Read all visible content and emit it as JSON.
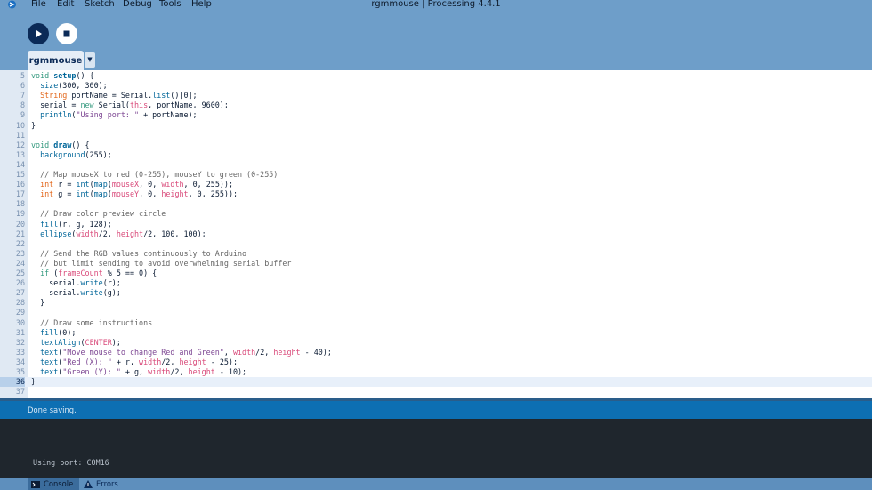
{
  "window": {
    "title": "rgmmouse | Processing 4.4.1"
  },
  "menu": {
    "items": [
      "File",
      "Edit",
      "Sketch",
      "Debug",
      "Tools",
      "Help"
    ]
  },
  "toolbar": {
    "run_icon": "play-icon",
    "stop_icon": "stop-icon"
  },
  "tabs": {
    "active_label": "rgmmouse",
    "menu_icon": "chevron-down-icon"
  },
  "editor": {
    "current_line": 36,
    "lines": [
      {
        "n": "5",
        "text": "void setup() {"
      },
      {
        "n": "6",
        "text": "  size(300, 300);"
      },
      {
        "n": "7",
        "text": "  String portName = Serial.list()[0];"
      },
      {
        "n": "8",
        "text": "  serial = new Serial(this, portName, 9600);"
      },
      {
        "n": "9",
        "text": "  println(\"Using port: \" + portName);"
      },
      {
        "n": "10",
        "text": "}"
      },
      {
        "n": "11",
        "text": ""
      },
      {
        "n": "12",
        "text": "void draw() {"
      },
      {
        "n": "13",
        "text": "  background(255);"
      },
      {
        "n": "14",
        "text": ""
      },
      {
        "n": "15",
        "text": "  // Map mouseX to red (0-255), mouseY to green (0-255)"
      },
      {
        "n": "16",
        "text": "  int r = int(map(mouseX, 0, width, 0, 255));"
      },
      {
        "n": "17",
        "text": "  int g = int(map(mouseY, 0, height, 0, 255));"
      },
      {
        "n": "18",
        "text": ""
      },
      {
        "n": "19",
        "text": "  // Draw color preview circle"
      },
      {
        "n": "20",
        "text": "  fill(r, g, 128);"
      },
      {
        "n": "21",
        "text": "  ellipse(width/2, height/2, 100, 100);"
      },
      {
        "n": "22",
        "text": ""
      },
      {
        "n": "23",
        "text": "  // Send the RGB values continuously to Arduino"
      },
      {
        "n": "24",
        "text": "  // but limit sending to avoid overwhelming serial buffer"
      },
      {
        "n": "25",
        "text": "  if (frameCount % 5 == 0) {"
      },
      {
        "n": "26",
        "text": "    serial.write(r);"
      },
      {
        "n": "27",
        "text": "    serial.write(g);"
      },
      {
        "n": "28",
        "text": "  }"
      },
      {
        "n": "29",
        "text": ""
      },
      {
        "n": "30",
        "text": "  // Draw some instructions"
      },
      {
        "n": "31",
        "text": "  fill(0);"
      },
      {
        "n": "32",
        "text": "  textAlign(CENTER);"
      },
      {
        "n": "33",
        "text": "  text(\"Move mouse to change Red and Green\", width/2, height - 40);"
      },
      {
        "n": "34",
        "text": "  text(\"Red (X): \" + r, width/2, height - 25);"
      },
      {
        "n": "35",
        "text": "  text(\"Green (Y): \" + g, width/2, height - 10);"
      },
      {
        "n": "36",
        "text": "}"
      },
      {
        "n": "37",
        "text": ""
      }
    ]
  },
  "status": {
    "message": "Done saving."
  },
  "console": {
    "lines": [
      "Using port: COM16"
    ]
  },
  "bottom_tabs": [
    {
      "label": "Console",
      "icon": "terminal-icon",
      "active": true
    },
    {
      "label": "Errors",
      "icon": "warning-icon",
      "active": false
    }
  ],
  "colors": {
    "chrome": "#6e9ec9",
    "accent": "#0d6fb3",
    "keyword": "#33997e",
    "type": "#e2661a",
    "function": "#006699",
    "comment": "#666666",
    "string": "#7d4793",
    "variable": "#d94a7a"
  }
}
